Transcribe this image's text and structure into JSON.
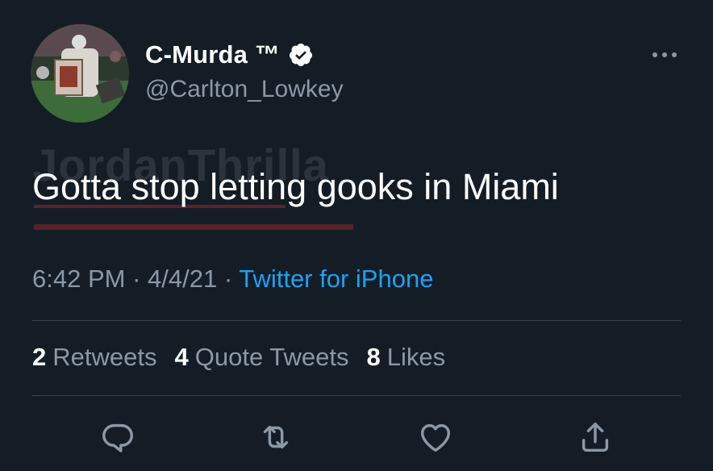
{
  "author": {
    "display_name": "C-Murda ™",
    "handle": "@Carlton_Lowkey",
    "verified": true
  },
  "watermark": "JordanThrilla",
  "tweet": {
    "text": "Gotta stop letting gooks in Miami"
  },
  "meta": {
    "time": "6:42 PM",
    "separator": " · ",
    "date": "4/4/21",
    "source": "Twitter for iPhone"
  },
  "stats": {
    "retweets_count": "2",
    "retweets_label": "Retweets",
    "quotes_count": "4",
    "quotes_label": "Quote Tweets",
    "likes_count": "8",
    "likes_label": "Likes"
  },
  "colors": {
    "background": "#141d26",
    "secondary_text": "#8b98a5",
    "link": "#1da1f2",
    "divider": "#38444d"
  },
  "icons": {
    "reply": "reply-icon",
    "retweet": "retweet-icon",
    "like": "heart-icon",
    "share": "share-icon",
    "more": "more-icon",
    "verified": "verified-badge-icon"
  }
}
